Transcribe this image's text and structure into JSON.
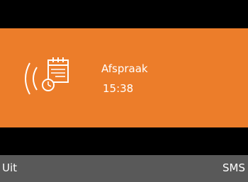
{
  "colors": {
    "background": "#000000",
    "alert_panel": "#ec7d2a",
    "softkey_bar": "#595959",
    "text": "#ffffff"
  },
  "alert": {
    "icons": [
      "ringing-sound-icon",
      "calendar-alarm-icon"
    ],
    "title": "Afspraak",
    "time": "15:38"
  },
  "softkeys": {
    "left_label": "Uit",
    "right_label": "SMS"
  }
}
